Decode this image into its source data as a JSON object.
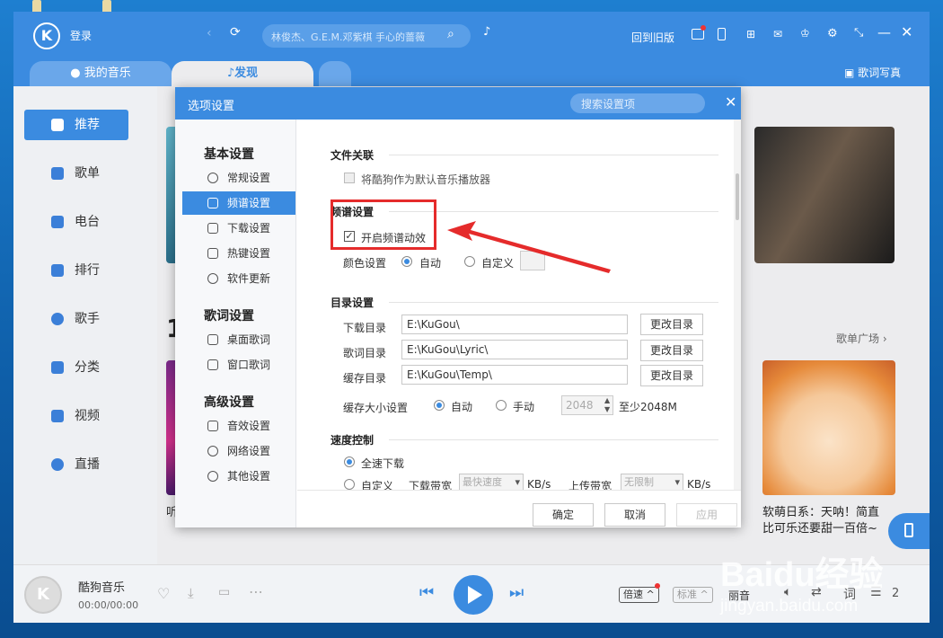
{
  "app": {
    "login": "登录",
    "search_placeholder": "林俊杰、G.E.M.邓紫棋 手心的蔷薇",
    "back_old": "回到旧版"
  },
  "tabs": {
    "my_music": "我的音乐",
    "discover": "发现",
    "lyrics_writing": "歌词写真"
  },
  "sidebar": {
    "items": [
      {
        "label": "推荐",
        "icon": "recommend-icon"
      },
      {
        "label": "歌单",
        "icon": "playlist-icon"
      },
      {
        "label": "电台",
        "icon": "radio-icon"
      },
      {
        "label": "排行",
        "icon": "rank-icon"
      },
      {
        "label": "歌手",
        "icon": "singer-icon"
      },
      {
        "label": "分类",
        "icon": "category-icon"
      },
      {
        "label": "视频",
        "icon": "video-icon"
      },
      {
        "label": "直播",
        "icon": "live-icon"
      }
    ]
  },
  "content": {
    "section_num": "14",
    "playlist_square": "歌单广场 ›",
    "left_caption": "听得",
    "card_title": "软萌日系：天呐！简直",
    "card_sub": "比可乐还要甜一百倍~"
  },
  "player": {
    "title": "酷狗音乐",
    "time": "00:00/00:00",
    "speed": "倍速",
    "quality": "标准",
    "mode": "丽音",
    "lyric": "词",
    "count": "2"
  },
  "dialog": {
    "title": "选项设置",
    "search_placeholder": "搜索设置项",
    "nav": {
      "basic": "基本设置",
      "basic_items": [
        "常规设置",
        "频谱设置",
        "下载设置",
        "热键设置",
        "软件更新"
      ],
      "lyrics": "歌词设置",
      "lyrics_items": [
        "桌面歌词",
        "窗口歌词"
      ],
      "advanced": "高级设置",
      "advanced_items": [
        "音效设置",
        "网络设置",
        "其他设置"
      ]
    },
    "file_assoc": {
      "title": "文件关联",
      "default_player": "将酷狗作为默认音乐播放器"
    },
    "spectrum": {
      "title": "频谱设置",
      "enable": "开启频谱动效",
      "color_label": "颜色设置",
      "auto": "自动",
      "custom": "自定义"
    },
    "dirs": {
      "title": "目录设置",
      "rows": [
        {
          "label": "下载目录",
          "value": "E:\\KuGou\\",
          "button": "更改目录"
        },
        {
          "label": "歌词目录",
          "value": "E:\\KuGou\\Lyric\\",
          "button": "更改目录"
        },
        {
          "label": "缓存目录",
          "value": "E:\\KuGou\\Temp\\",
          "button": "更改目录"
        }
      ],
      "cache_size_label": "缓存大小设置",
      "auto": "自动",
      "manual": "手动",
      "size_value": "2048",
      "min_note": "至少2048M"
    },
    "speed": {
      "title": "速度控制",
      "full": "全速下载",
      "custom": "自定义",
      "down_label": "下载带宽",
      "down_value": "最快速度",
      "unit1": "KB/s",
      "up_label": "上传带宽",
      "up_value": "无限制",
      "unit2": "KB/s"
    },
    "buttons": {
      "ok": "确定",
      "cancel": "取消",
      "apply": "应用"
    }
  },
  "watermark": {
    "brand": "Baidu经验",
    "url": "jingyan.baidu.com"
  },
  "colors": {
    "accent": "#3b8be0",
    "annotation": "#e52b2b"
  }
}
